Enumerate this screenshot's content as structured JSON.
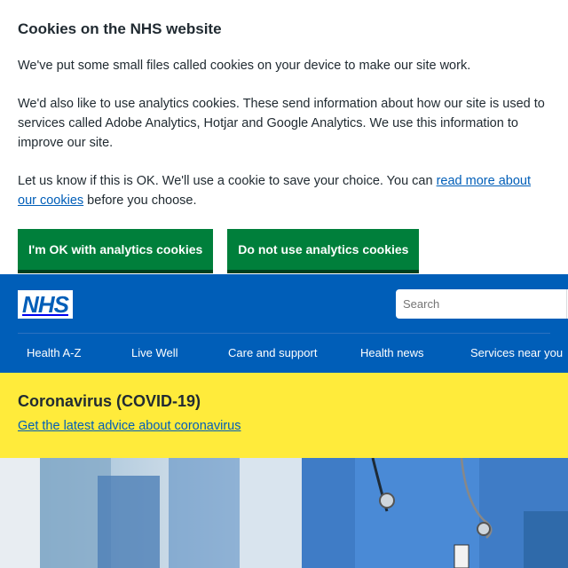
{
  "cookie_banner": {
    "title": "Cookies on the NHS website",
    "p1": "We've put some small files called cookies on your device to make our site work.",
    "p2": "We'd also like to use analytics cookies. These send information about how our site is used to services called Adobe Analytics, Hotjar and Google Analytics. We use this information to improve our site.",
    "p3_before": "Let us know if this is OK. We'll use a cookie to save your choice. You can ",
    "p3_link": "read more about our cookies",
    "p3_after": " before you choose.",
    "accept_label": "I'm OK with analytics cookies",
    "reject_label": "Do not use analytics cookies"
  },
  "header": {
    "logo_text": "NHS",
    "search_placeholder": "Search",
    "nav": [
      "Health A-Z",
      "Live Well",
      "Care and support",
      "Health news",
      "Services near you"
    ]
  },
  "alert": {
    "title": "Coronavirus (COVID-19)",
    "link": "Get the latest advice about coronavirus"
  },
  "colors": {
    "nhs_blue": "#005eb8",
    "green_button": "#007f3b",
    "alert_yellow": "#ffeb3b"
  }
}
